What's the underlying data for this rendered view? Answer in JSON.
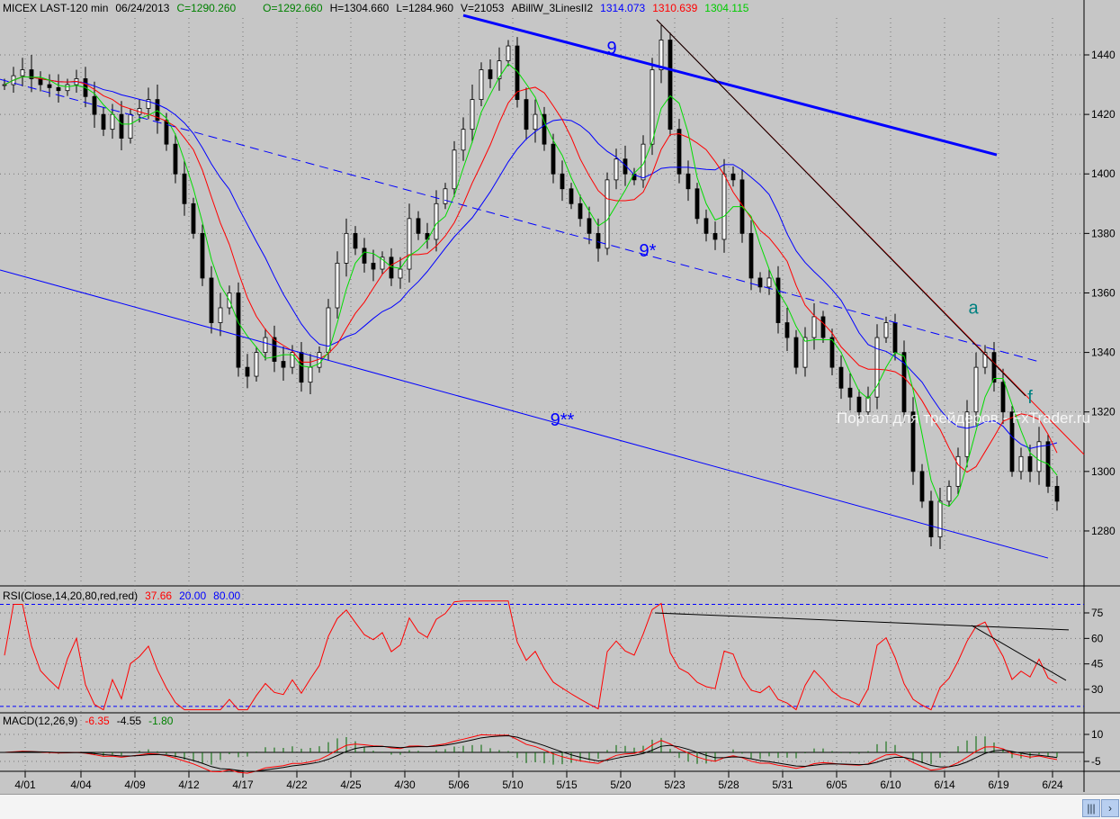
{
  "header": {
    "symbol": "MICEX LAST-120 min",
    "date": "06/24/2013",
    "close": "C=1290.260",
    "open": "O=1292.660",
    "high": "H=1304.660",
    "low": "L=1284.960",
    "volume": "V=21053",
    "indicator": "ABillW_3LinesII2",
    "ma_blue": "1314.073",
    "ma_red": "1310.639",
    "ma_green": "1304.115"
  },
  "rsi_header": {
    "label": "RSI(Close,14,20,80,red,red)",
    "value": "37.66",
    "low": "20.00",
    "high": "80.00"
  },
  "macd_header": {
    "label": "MACD(12,26,9)",
    "macd": "-6.35",
    "signal": "-4.55",
    "hist": "-1.80"
  },
  "watermark": "Портал для трейдеров - FxTrader.ru",
  "colors": {
    "bg": "#c6c6c6",
    "blue": "#0000ff",
    "red": "#ff0000",
    "green": "#00cc00",
    "teal": "#008080"
  },
  "chart_data": {
    "type": "line",
    "title": "MICEX LAST-120 min",
    "price_ylim": [
      1260,
      1458
    ],
    "price_ticks": [
      1280,
      1300,
      1320,
      1340,
      1360,
      1380,
      1400,
      1420,
      1440
    ],
    "rsi_ticks": [
      30,
      45,
      60,
      75
    ],
    "rsi_levels": [
      20,
      80
    ],
    "macd_ticks": [
      10,
      -5
    ],
    "x_ticks": [
      {
        "label": "4/01",
        "i": 2.3
      },
      {
        "label": "4/04",
        "i": 8.5
      },
      {
        "label": "4/09",
        "i": 14.5
      },
      {
        "label": "4/12",
        "i": 20.5
      },
      {
        "label": "4/17",
        "i": 26.5
      },
      {
        "label": "4/22",
        "i": 32.5
      },
      {
        "label": "4/25",
        "i": 38.5
      },
      {
        "label": "4/30",
        "i": 44.5
      },
      {
        "label": "5/06",
        "i": 50.5
      },
      {
        "label": "5/10",
        "i": 56.5
      },
      {
        "label": "5/15",
        "i": 62.5
      },
      {
        "label": "5/20",
        "i": 68.5
      },
      {
        "label": "5/23",
        "i": 74.5
      },
      {
        "label": "5/28",
        "i": 80.5
      },
      {
        "label": "5/31",
        "i": 86.5
      },
      {
        "label": "6/05",
        "i": 92.5
      },
      {
        "label": "6/10",
        "i": 98.5
      },
      {
        "label": "6/14",
        "i": 104.5
      },
      {
        "label": "6/19",
        "i": 110.5
      },
      {
        "label": "6/24",
        "i": 116.5
      }
    ],
    "closes": [
      1430,
      1433,
      1435,
      1432,
      1430,
      1429,
      1428,
      1430,
      1432,
      1426,
      1420,
      1415,
      1420,
      1412,
      1420,
      1422,
      1425,
      1418,
      1410,
      1400,
      1390,
      1380,
      1365,
      1350,
      1355,
      1360,
      1335,
      1332,
      1340,
      1345,
      1337,
      1335,
      1340,
      1330,
      1335,
      1340,
      1355,
      1370,
      1380,
      1375,
      1370,
      1368,
      1372,
      1365,
      1368,
      1385,
      1380,
      1378,
      1390,
      1395,
      1408,
      1415,
      1425,
      1435,
      1432,
      1438,
      1443,
      1425,
      1415,
      1420,
      1410,
      1400,
      1395,
      1390,
      1385,
      1380,
      1375,
      1398,
      1405,
      1400,
      1398,
      1410,
      1435,
      1445,
      1415,
      1400,
      1395,
      1385,
      1380,
      1378,
      1400,
      1398,
      1380,
      1365,
      1362,
      1365,
      1350,
      1345,
      1335,
      1345,
      1352,
      1345,
      1335,
      1328,
      1325,
      1320,
      1325,
      1345,
      1350,
      1340,
      1320,
      1300,
      1290,
      1278,
      1290,
      1295,
      1305,
      1320,
      1335,
      1340,
      1330,
      1320,
      1300,
      1305,
      1300,
      1310,
      1295,
      1290
    ],
    "moving_averages": [
      {
        "name": "blue",
        "period": 14,
        "last": 1314.073
      },
      {
        "name": "red",
        "period": 8,
        "last": 1310.639
      },
      {
        "name": "green",
        "period": 4,
        "last": 1304.115
      }
    ],
    "trendlines": [
      {
        "name": "line-9",
        "label": "9",
        "style": "thick",
        "color": "#0000ff",
        "p1": [
          51,
          1453.3
        ],
        "p2": [
          110.3,
          1406.4
        ],
        "label_at": [
          67.5,
          1440.3
        ]
      },
      {
        "name": "line-9-star",
        "label": "9*",
        "style": "dashed",
        "color": "#0000ff",
        "p1": [
          -0.5,
          1431.8
        ],
        "p2": [
          115,
          1336.9
        ],
        "label_at": [
          71.5,
          1372.2
        ]
      },
      {
        "name": "line-9-2star",
        "label": "9**",
        "style": "thin",
        "color": "#0000ff",
        "p1": [
          -0.5,
          1367.7
        ],
        "p2": [
          116,
          1270.9
        ],
        "label_at": [
          62,
          1315.4
        ]
      },
      {
        "name": "red-resistance",
        "label": "",
        "style": "thin",
        "color": "#ff0000",
        "p1": [
          72.5,
          1451.8
        ],
        "p2": [
          120,
          1305.7
        ]
      },
      {
        "name": "black-resistance",
        "label": "",
        "style": "thin",
        "color": "#000000",
        "p1": [
          72.5,
          1451.8
        ],
        "p2": [
          113.5,
          1325.4
        ]
      }
    ],
    "annotations": [
      {
        "label": "a",
        "color": "#008080",
        "at": [
          107.7,
          1353
        ]
      },
      {
        "label": "f",
        "color": "#008080",
        "at": [
          114,
          1322.9
        ]
      }
    ],
    "rsi_trendlines": [
      {
        "p1": [
          72.3,
          75
        ],
        "p2": [
          118.3,
          65
        ]
      },
      {
        "p1": [
          107.5,
          67.6
        ],
        "p2": [
          118,
          35.3
        ]
      }
    ]
  }
}
